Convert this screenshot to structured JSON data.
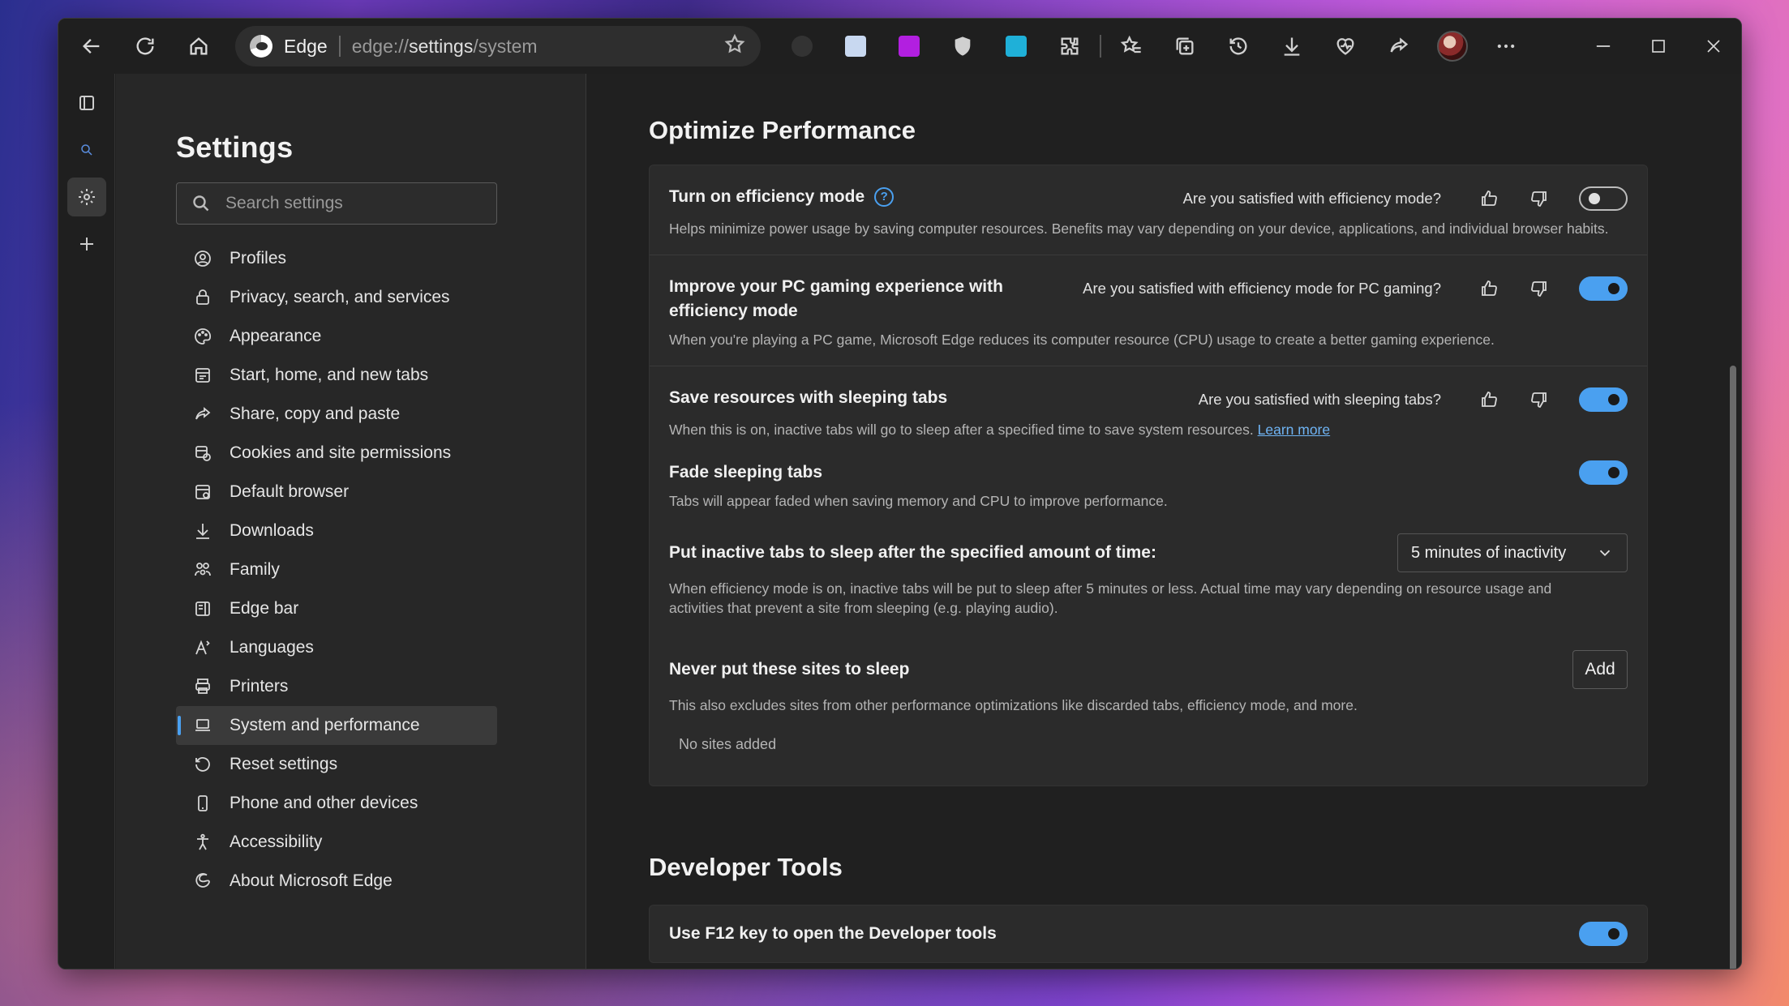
{
  "titlebar": {
    "brand": "Edge",
    "url_prefix": "edge://",
    "url_path": "settings",
    "url_suffix": "/system"
  },
  "sidebar": {
    "title": "Settings",
    "search_placeholder": "Search settings",
    "items": [
      {
        "label": "Profiles",
        "icon": "profile-icon"
      },
      {
        "label": "Privacy, search, and services",
        "icon": "lock-icon"
      },
      {
        "label": "Appearance",
        "icon": "palette-icon"
      },
      {
        "label": "Start, home, and new tabs",
        "icon": "home-tabs-icon"
      },
      {
        "label": "Share, copy and paste",
        "icon": "share-icon"
      },
      {
        "label": "Cookies and site permissions",
        "icon": "cookie-icon"
      },
      {
        "label": "Default browser",
        "icon": "browser-icon"
      },
      {
        "label": "Downloads",
        "icon": "download-icon"
      },
      {
        "label": "Family",
        "icon": "family-icon"
      },
      {
        "label": "Edge bar",
        "icon": "edge-bar-icon"
      },
      {
        "label": "Languages",
        "icon": "languages-icon"
      },
      {
        "label": "Printers",
        "icon": "printer-icon"
      },
      {
        "label": "System and performance",
        "icon": "laptop-icon",
        "active": true
      },
      {
        "label": "Reset settings",
        "icon": "reset-icon"
      },
      {
        "label": "Phone and other devices",
        "icon": "phone-icon"
      },
      {
        "label": "Accessibility",
        "icon": "accessibility-icon"
      },
      {
        "label": "About Microsoft Edge",
        "icon": "edge-logo-icon"
      }
    ]
  },
  "optimize": {
    "title": "Optimize Performance",
    "efficiency": {
      "title": "Turn on efficiency mode",
      "question": "Are you satisfied with efficiency mode?",
      "desc": "Helps minimize power usage by saving computer resources. Benefits may vary depending on your device, applications, and individual browser habits.",
      "enabled": false
    },
    "gaming": {
      "title": "Improve your PC gaming experience with efficiency mode",
      "question": "Are you satisfied with efficiency mode for PC gaming?",
      "desc": "When you're playing a PC game, Microsoft Edge reduces its computer resource (CPU) usage to create a better gaming experience.",
      "enabled": true
    },
    "sleeping": {
      "title": "Save resources with sleeping tabs",
      "question": "Are you satisfied with sleeping tabs?",
      "desc": "When this is on, inactive tabs will go to sleep after a specified time to save system resources.",
      "learn_more": "Learn more",
      "enabled": true
    },
    "fade": {
      "title": "Fade sleeping tabs",
      "desc": "Tabs will appear faded when saving memory and CPU to improve performance.",
      "enabled": true
    },
    "inactive": {
      "title": "Put inactive tabs to sleep after the specified amount of time:",
      "selected": "5 minutes of inactivity",
      "desc": "When efficiency mode is on, inactive tabs will be put to sleep after 5 minutes or less. Actual time may vary depending on resource usage and activities that prevent a site from sleeping (e.g. playing audio)."
    },
    "never": {
      "title": "Never put these sites to sleep",
      "add_label": "Add",
      "desc": "This also excludes sites from other performance optimizations like discarded tabs, efficiency mode, and more.",
      "empty": "No sites added"
    }
  },
  "devtools": {
    "title": "Developer Tools",
    "f12": {
      "title": "Use F12 key to open the Developer tools",
      "enabled": true
    }
  },
  "colors": {
    "accent": "#4aa0f0",
    "window_bg": "#202020",
    "sidebar_bg": "#272727",
    "card_bg": "#2b2b2b"
  }
}
